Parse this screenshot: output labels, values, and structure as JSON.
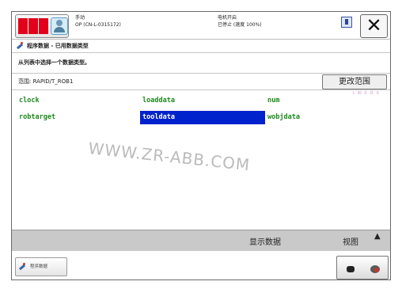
{
  "header": {
    "mode": "手动",
    "controller": "OP (CN-L-0315172)",
    "motor_state": "电机开启",
    "run_state": "已停止 (速度 100%)"
  },
  "page": {
    "title": "程序数据 - 已用数据类型",
    "instruction": "从列表中选择一个数据类型。",
    "scope": "范围: RAPID/T_ROB1",
    "change_scope_label": "更改范围",
    "counter": "1 到 6 共 6"
  },
  "data_types": [
    "clock",
    "loaddata",
    "num",
    "robtarget",
    "tooldata",
    "wobjdata"
  ],
  "selected_index": 4,
  "watermark": "WWW.ZR-ABB.COM",
  "command_bar": {
    "show_data_label": "显示数据",
    "view_label": "视图",
    "scroll_up_glyph": "▲"
  },
  "taskbar": {
    "task_label": "程序数据"
  },
  "colors": {
    "brand": "#e2001a",
    "item_text": "#1a8a1a",
    "selection": "#0022cc"
  }
}
